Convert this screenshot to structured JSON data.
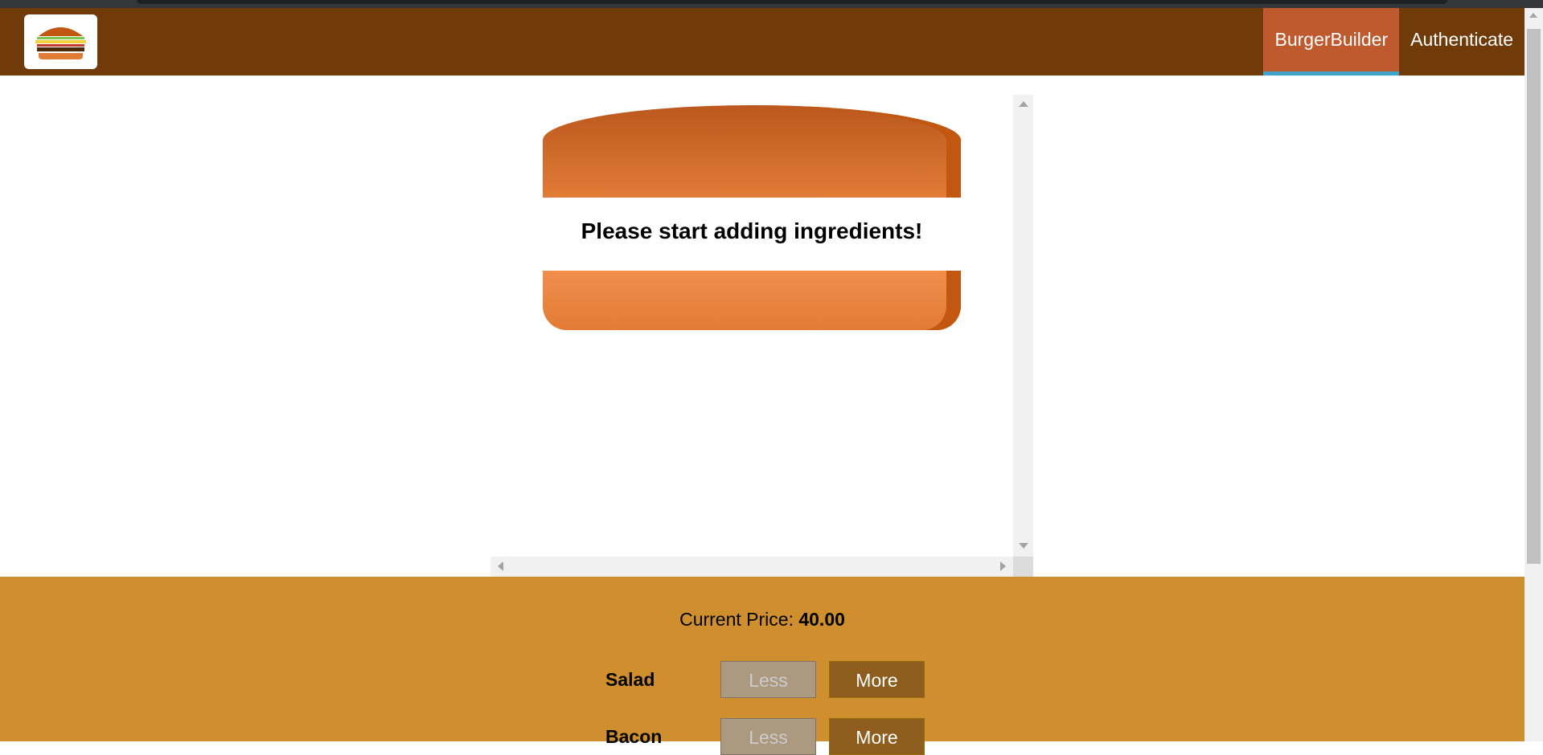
{
  "header": {
    "logo_icon": "burger-icon",
    "nav": [
      {
        "label": "BurgerBuilder",
        "active": true
      },
      {
        "label": "Authenticate",
        "active": false
      }
    ]
  },
  "burger": {
    "message": "Please start adding ingredients!"
  },
  "controls": {
    "price_label": "Current Price:",
    "price_value": "40.00",
    "rows": [
      {
        "label": "Salad",
        "less": "Less",
        "more": "More"
      },
      {
        "label": "Bacon",
        "less": "Less",
        "more": "More"
      }
    ]
  },
  "colors": {
    "toolbar": "#703b09",
    "active_nav": "#bf5a2e",
    "active_underline": "#40a4c8",
    "controls_bg": "#cf8f2e",
    "more_button": "#8f5e1e",
    "less_button_disabled": "#ac9980"
  }
}
